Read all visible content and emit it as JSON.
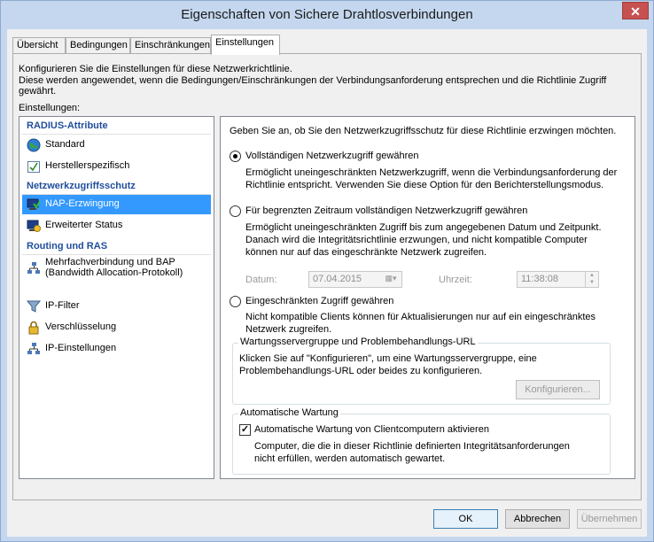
{
  "window": {
    "title": "Eigenschaften von Sichere Drahtlosverbindungen",
    "close_glyph": "✕"
  },
  "tabs": [
    {
      "label": "Übersicht"
    },
    {
      "label": "Bedingungen"
    },
    {
      "label": "Einschränkungen"
    },
    {
      "label": "Einstellungen",
      "active": true
    }
  ],
  "intro": {
    "line1": "Konfigurieren Sie die Einstellungen für diese Netzwerkrichtlinie.",
    "line2": "Diese werden angewendet, wenn die Bedingungen/Einschränkungen der Verbindungsanforderung entsprechen und die Richtlinie Zugriff gewährt.",
    "settings_label": "Einstellungen:"
  },
  "settings_list": {
    "group_radius": "RADIUS-Attribute",
    "standard": "Standard",
    "vendor": "Herstellerspezifisch",
    "group_nap": "Netzwerkzugriffsschutz",
    "nap_enforcement": "NAP-Erzwingung",
    "extended_state": "Erweiterter Status",
    "group_routing": "Routing und RAS",
    "multilink": "Mehrfachverbindung und BAP (Bandwidth Allocation-Protokoll)",
    "ip_filter": "IP-Filter",
    "encryption": "Verschlüsselung",
    "ip_settings": "IP-Einstellungen"
  },
  "nap_panel": {
    "heading": "Geben Sie an, ob Sie den Netzwerkzugriffsschutz für diese Richtlinie erzwingen möchten.",
    "opt_full": "Vollständigen Netzwerkzugriff gewähren",
    "opt_full_desc": "Ermöglicht uneingeschränkten Netzwerkzugriff, wenn die Verbindungsanforderung der Richtlinie entspricht. Verwenden Sie diese Option für den Berichterstellungsmodus.",
    "opt_limited_time": "Für begrenzten Zeitraum vollständigen Netzwerkzugriff gewähren",
    "opt_limited_time_desc": "Ermöglicht uneingeschränkten Zugriff bis zum angegebenen Datum und Zeitpunkt. Danach wird die Integritätsrichtlinie erzwungen, und nicht kompatible Computer können nur auf das eingeschränkte Netzwerk zugreifen.",
    "date_label": "Datum:",
    "date_value": "07.04.2015",
    "time_label": "Uhrzeit:",
    "time_value": "11:38:08",
    "opt_restricted": "Eingeschränkten Zugriff gewähren",
    "opt_restricted_desc": "Nicht kompatible Clients können für Aktualisierungen nur auf ein eingeschränktes Netzwerk zugreifen.",
    "remediation_group_title": "Wartungsservergruppe und Problembehandlungs-URL",
    "remediation_text": "Klicken Sie auf \"Konfigurieren\", um eine Wartungsservergruppe, eine Problembehandlungs-URL oder beides zu konfigurieren.",
    "configure_button": "Konfigurieren...",
    "auto_group_title": "Automatische Wartung",
    "auto_checkbox_label": "Automatische Wartung von Clientcomputern aktivieren",
    "auto_desc": "Computer, die die in dieser Richtlinie definierten Integritätsanforderungen nicht erfüllen, werden automatisch gewartet."
  },
  "footer": {
    "ok": "OK",
    "cancel": "Abbrechen",
    "apply": "Übernehmen"
  },
  "colors": {
    "titlebar": "#c4d7ef",
    "selection": "#3399ff",
    "group_heading": "#1f4e9c",
    "close": "#c75050"
  }
}
